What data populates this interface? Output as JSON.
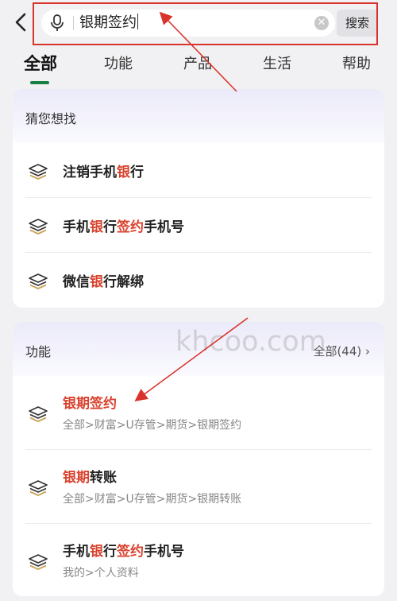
{
  "search": {
    "query": "银期签约",
    "button_label": "搜索"
  },
  "tabs": [
    {
      "label": "全部"
    },
    {
      "label": "功能"
    },
    {
      "label": "产品"
    },
    {
      "label": "生活"
    },
    {
      "label": "帮助"
    }
  ],
  "guess": {
    "title": "猜您想找",
    "items": [
      {
        "parts": [
          {
            "t": "注销手机",
            "h": false
          },
          {
            "t": "银",
            "h": true
          },
          {
            "t": "行",
            "h": false
          }
        ]
      },
      {
        "parts": [
          {
            "t": "手机",
            "h": false
          },
          {
            "t": "银",
            "h": true
          },
          {
            "t": "行",
            "h": false
          },
          {
            "t": "签约",
            "h": true
          },
          {
            "t": "手机号",
            "h": false
          }
        ]
      },
      {
        "parts": [
          {
            "t": "微信",
            "h": false
          },
          {
            "t": "银",
            "h": true
          },
          {
            "t": "行解绑",
            "h": false
          }
        ]
      }
    ]
  },
  "functions": {
    "title": "功能",
    "more": "全部(44) ›",
    "items": [
      {
        "parts": [
          {
            "t": "银期签约",
            "h": true
          }
        ],
        "path": "全部>财富>U存管>期货>银期签约"
      },
      {
        "parts": [
          {
            "t": "银期",
            "h": true
          },
          {
            "t": "转账",
            "h": false
          }
        ],
        "path": "全部>财富>U存管>期货>银期转账"
      },
      {
        "parts": [
          {
            "t": "手机",
            "h": false
          },
          {
            "t": "银",
            "h": true
          },
          {
            "t": "行",
            "h": false
          },
          {
            "t": "签约",
            "h": true
          },
          {
            "t": "手机号",
            "h": false
          }
        ],
        "path": "我的>个人资料"
      }
    ]
  },
  "watermark": "khcoo.com",
  "colors": {
    "accent": "#1a7f43",
    "highlight": "#d9432f",
    "annotation": "#d9342b"
  }
}
